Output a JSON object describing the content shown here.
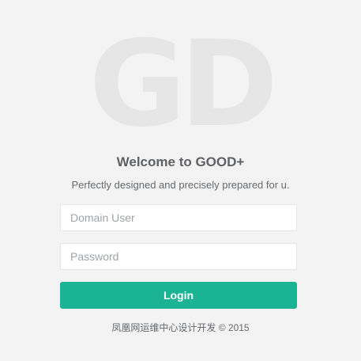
{
  "logo": {
    "text": "GD"
  },
  "welcome": {
    "title": "Welcome to GOOD+"
  },
  "subtitle": {
    "text": "Perfectly designed and precisely prepared for u."
  },
  "form": {
    "username_placeholder": "Domain User",
    "password_placeholder": "Password",
    "login_label": "Login"
  },
  "footer": {
    "text": "凤凰网运维中心设计开发 © 2015"
  },
  "colors": {
    "background": "#f3f3f4",
    "accent": "#1ab394",
    "logo": "#e6e6e6",
    "text": "#676a6c"
  }
}
